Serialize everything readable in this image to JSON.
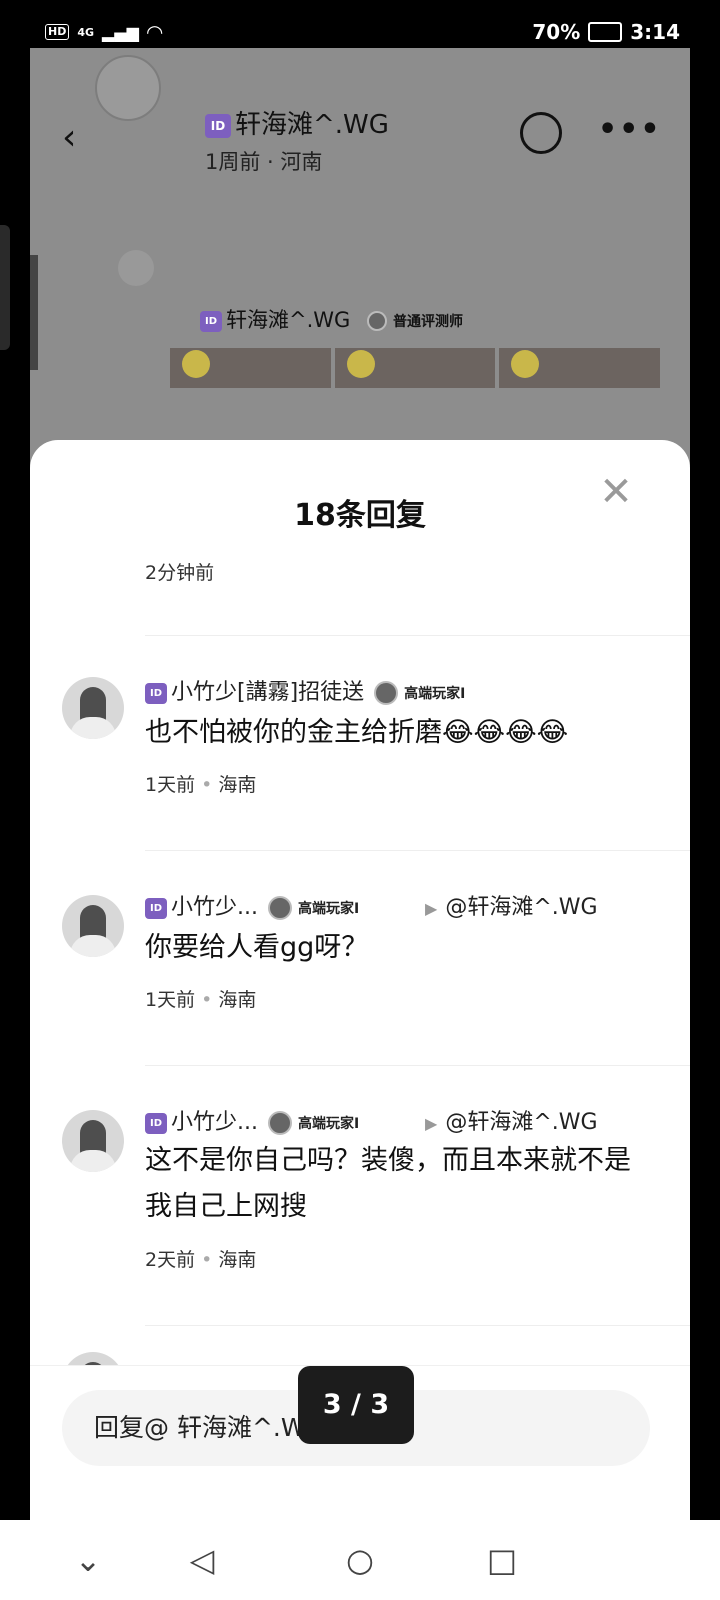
{
  "status_bar": {
    "network": "HD",
    "signal": "4G",
    "battery": "70%",
    "time": "3:14"
  },
  "post_header": {
    "username": "轩海滩^.WG",
    "meta": "1周前 · 河南"
  },
  "post": {
    "username": "轩海滩^.WG",
    "badge": "普通评测师",
    "text": "。"
  },
  "sheet": {
    "title": "18条回复",
    "first_time": "2分钟前"
  },
  "comments": [
    {
      "username": "小竹少[講霧]招徒送",
      "badge": "高端玩家I",
      "reply_to": "",
      "text": "也不怕被你的金主给折磨😂😂😂😂",
      "time": "1天前",
      "location": "海南"
    },
    {
      "username": "小竹少...",
      "badge": "高端玩家I",
      "reply_to": "@轩海滩^.WG",
      "text": "你要给人看gg呀？",
      "time": "1天前",
      "location": "海南"
    },
    {
      "username": "小竹少...",
      "badge": "高端玩家I",
      "reply_to": "@轩海滩^.WG",
      "text": "这不是你自己吗？装傻，而且本来就不是我自己上网搜",
      "time": "2天前",
      "location": "海南"
    }
  ],
  "input": {
    "placeholder": "回复@ 轩海滩^.WG"
  },
  "page_indicator": "3 / 3",
  "icons": {
    "id_badge": "ID",
    "close": "close-icon",
    "back": "back-icon",
    "share": "share-icon",
    "more": "more-icon"
  },
  "colors": {
    "id_badge": "#7d5fbf",
    "overlay": "#8d8d8d",
    "sheet": "#ffffff"
  }
}
